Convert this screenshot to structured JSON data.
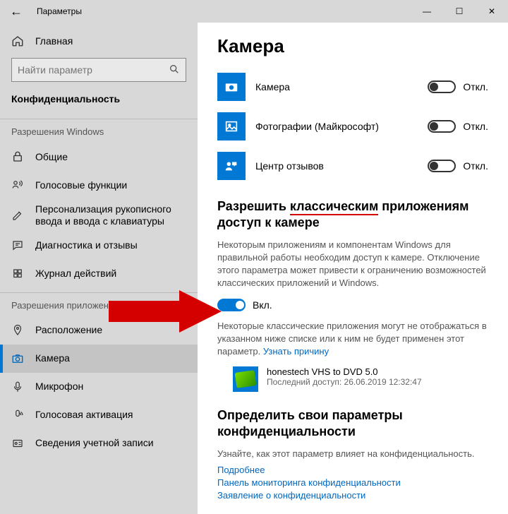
{
  "window": {
    "title": "Параметры",
    "min": "—",
    "max": "☐",
    "close": "✕"
  },
  "sidebar": {
    "home": "Главная",
    "search_placeholder": "Найти параметр",
    "section": "Конфиденциальность",
    "group1": "Разрешения Windows",
    "group2": "Разрешения приложений",
    "items": [
      {
        "label": "Общие"
      },
      {
        "label": "Голосовые функции"
      },
      {
        "label": "Персонализация рукописного ввода и ввода с клавиатуры"
      },
      {
        "label": "Диагностика и отзывы"
      },
      {
        "label": "Журнал действий"
      },
      {
        "label": "Расположение"
      },
      {
        "label": "Камера"
      },
      {
        "label": "Микрофон"
      },
      {
        "label": "Голосовая активация"
      },
      {
        "label": "Сведения учетной записи"
      }
    ]
  },
  "content": {
    "heading": "Камера",
    "apps": [
      {
        "name": "Камера",
        "state": "Откл."
      },
      {
        "name": "Фотографии (Майкрософт)",
        "state": "Откл."
      },
      {
        "name": "Центр отзывов",
        "state": "Откл."
      }
    ],
    "section2_pre": "Разрешить ",
    "section2_underlined": "классическим",
    "section2_post": " приложениям доступ к камере",
    "s2_desc": "Некоторым приложениям и компонентам Windows для правильной работы необходим доступ к камере. Отключение этого параметра может привести к ограничению возможностей классических приложений и Windows.",
    "s2_toggle": "Вкл.",
    "s2_note_pre": "Некоторые классические приложения могут не отображаться в указанном ниже списке или к ним не будет применен этот параметр. ",
    "s2_note_link": "Узнать причину",
    "classic_app": {
      "name": "honestech VHS to DVD 5.0",
      "last": "Последний доступ: 26.06.2019 12:32:47"
    },
    "section3": "Определить свои параметры конфиденциальности",
    "s3_desc": "Узнайте, как этот параметр влияет на конфиденциальность.",
    "links": [
      "Подробнее",
      "Панель мониторинга конфиденциальности",
      "Заявление о конфиденциальности"
    ]
  }
}
